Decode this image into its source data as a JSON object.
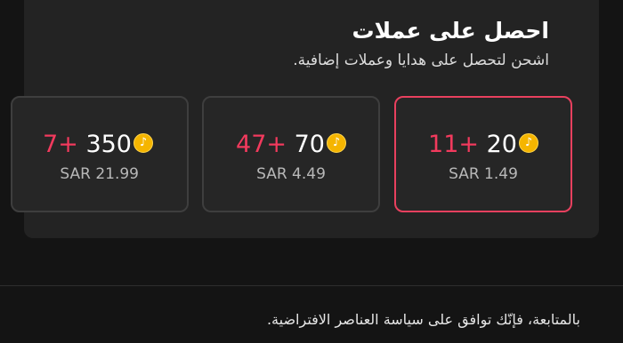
{
  "header": {
    "title": "احصل على عملات",
    "subtitle": "اشحن لتحصل على هدايا وعملات إضافية."
  },
  "packages": [
    {
      "amount": "20",
      "bonus": "11+",
      "price": "SAR 1.49",
      "selected": true
    },
    {
      "amount": "70",
      "bonus": "47+",
      "price": "SAR 4.49",
      "selected": false
    },
    {
      "amount": "350",
      "bonus": "7+",
      "price": "SAR 21.99",
      "selected": false
    }
  ],
  "coin_icon": {
    "name": "tiktok-coin-icon",
    "glyph": "♪",
    "color": "#f5b500"
  },
  "accent_color": "#e8405e",
  "footer": {
    "notice": "بالمتابعة، فإنّك توافق على سياسة العناصر الافتراضية."
  }
}
